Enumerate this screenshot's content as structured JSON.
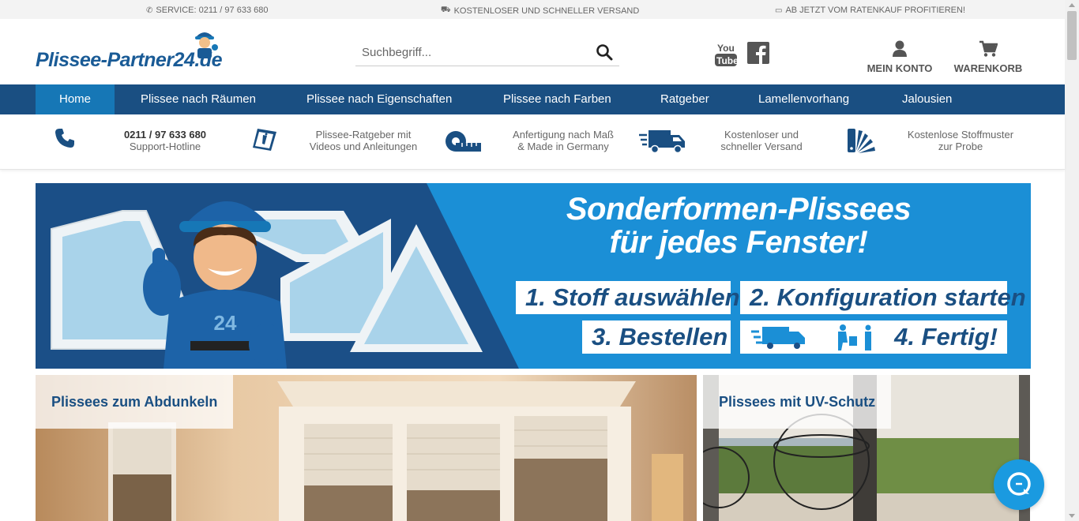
{
  "topbar": {
    "service": "SERVICE: 0211 / 97 633 680",
    "shipping": "KOSTENLOSER UND SCHNELLER VERSAND",
    "financing": "AB JETZT VOM RATENKAUF PROFITIEREN!"
  },
  "logo": {
    "text": "Plissee-Partner24.de"
  },
  "search": {
    "placeholder": "Suchbegriff..."
  },
  "social": {
    "youtube_label": "You Tube"
  },
  "account": {
    "label": "MEIN KONTO"
  },
  "cart": {
    "label": "WARENKORB"
  },
  "nav": {
    "items": [
      "Home",
      "Plissee nach Räumen",
      "Plissee nach Eigenschaften",
      "Plissee nach Farben",
      "Ratgeber",
      "Lamellenvorhang",
      "Jalousien"
    ],
    "active": "Home"
  },
  "features": {
    "hotline": {
      "line1": "0211 / 97 633 680",
      "line2": "Support-Hotline"
    },
    "guide": {
      "line1": "Plissee-Ratgeber mit",
      "line2": "Videos und Anleitungen"
    },
    "custom": {
      "line1": "Anfertigung nach Maß",
      "line2": "& Made in Germany"
    },
    "shipping": {
      "line1": "Kostenloser und",
      "line2": "schneller Versand"
    },
    "samples": {
      "line1": "Kostenlose Stoffmuster",
      "line2": "zur Probe"
    }
  },
  "banner": {
    "title_line1": "Sonderformen-Plissees",
    "title_line2": "für jedes Fenster!",
    "step1": "1. Stoff auswählen",
    "step2": "2. Konfiguration starten",
    "step3": "3. Bestellen",
    "step4": "4. Fertig!",
    "mascot_number": "24"
  },
  "tiles": {
    "left": "Plissees zum Abdunkeln",
    "right": "Plissees mit UV-Schutz"
  },
  "colors": {
    "brand_dark": "#1a4f82",
    "brand_light": "#1677b6",
    "banner_blue": "#1b8fd6",
    "chat": "#1a9ae0"
  }
}
